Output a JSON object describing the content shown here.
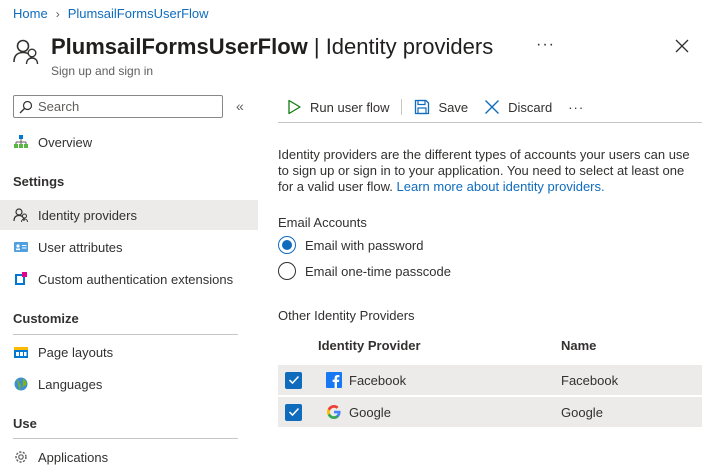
{
  "breadcrumb": {
    "home": "Home",
    "current": "PlumsailFormsUserFlow"
  },
  "header": {
    "title_bold": "PlumsailFormsUserFlow",
    "title_rest": " | Identity providers",
    "subtitle": "Sign up and sign in",
    "more": "···"
  },
  "sidebar": {
    "search_placeholder": "Search",
    "collapse": "«",
    "overview": "Overview",
    "sections": {
      "settings": "Settings",
      "customize": "Customize",
      "use": "Use"
    },
    "items": {
      "identity_providers": "Identity providers",
      "user_attributes": "User attributes",
      "custom_auth": "Custom authentication extensions",
      "page_layouts": "Page layouts",
      "languages": "Languages",
      "applications": "Applications"
    }
  },
  "toolbar": {
    "run": "Run user flow",
    "save": "Save",
    "discard": "Discard",
    "more": "···"
  },
  "description": {
    "text": "Identity providers are the different types of accounts your users can use to sign up or sign in to your application. You need to select at least one for a valid user flow. ",
    "link": "Learn more about identity providers."
  },
  "email_accounts": {
    "label": "Email Accounts",
    "options": [
      {
        "label": "Email with password",
        "checked": true
      },
      {
        "label": "Email one-time passcode",
        "checked": false
      }
    ]
  },
  "other_providers": {
    "label": "Other Identity Providers",
    "columns": {
      "provider": "Identity Provider",
      "name": "Name"
    },
    "rows": [
      {
        "provider": "Facebook",
        "name": "Facebook",
        "icon": "facebook-icon",
        "checked": true
      },
      {
        "provider": "Google",
        "name": "Google",
        "icon": "google-icon",
        "checked": true
      }
    ]
  },
  "colors": {
    "accent": "#0f6cbd",
    "selected_bg": "#edebe9",
    "facebook": "#1877f2"
  }
}
